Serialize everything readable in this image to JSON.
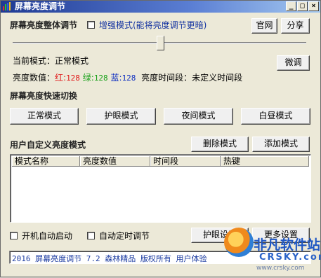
{
  "window": {
    "title": "屏幕亮度调节",
    "controls": {
      "minimize": "_",
      "maximize": "□",
      "close": "×"
    }
  },
  "main": {
    "section_title": "屏幕亮度整体调节",
    "enhance_mode_label": "增强模式(能将亮度调节更暗)",
    "enhance_mode_checked": false,
    "official_site_button": "官网",
    "share_button": "分享",
    "slider_value_fraction": 0.5,
    "current_mode_label": "当前模式：正常模式",
    "fine_tune_button": "微调",
    "brightness": {
      "label": "亮度数值：",
      "red_label": "红:",
      "red_value": "128",
      "green_label": "绿:",
      "green_value": "128",
      "blue_label": "蓝:",
      "blue_value": "128",
      "period_label": "亮度时间段：未定义时间段",
      "red_color": "#e01818",
      "green_color": "#18a018",
      "blue_color": "#1030c0"
    }
  },
  "quick_switch": {
    "title": "屏幕亮度快速切换",
    "buttons": [
      "正常模式",
      "护眼模式",
      "夜间模式",
      "白昼模式"
    ]
  },
  "custom": {
    "title": "用户自定义亮度模式",
    "delete_button": "删除模式",
    "add_button": "添加模式",
    "columns": [
      "模式名称",
      "亮度数值",
      "时间段",
      "热键"
    ],
    "rows": []
  },
  "options": {
    "autostart_label": "开机自动启动",
    "autostart_checked": false,
    "autotimer_label": "自动定时调节",
    "autotimer_checked": false,
    "eye_settings_button": "护眼设置",
    "more_settings_button": "更多设置"
  },
  "status_text": "2016 屏幕亮度调节 7.2 森林精品 版权所有 用户体验",
  "watermark": {
    "cn_text": "非凡软件站",
    "en_text": "CRSKY.com",
    "sub_text": "www.crsky.com"
  }
}
